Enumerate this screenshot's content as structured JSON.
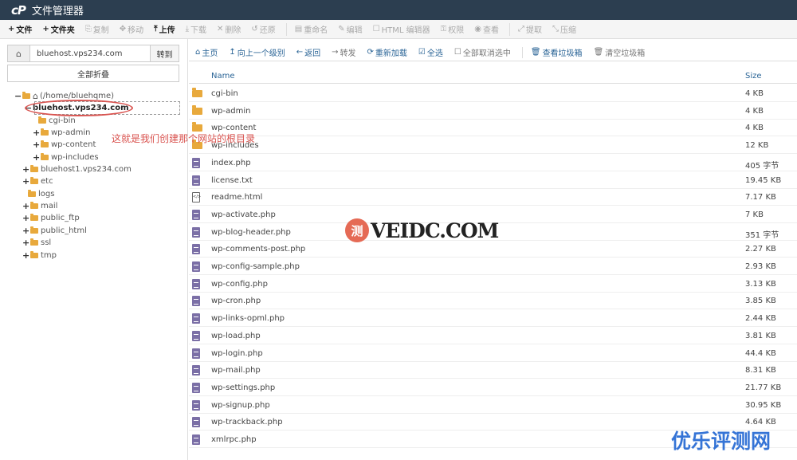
{
  "title_bar": {
    "logo": "cP",
    "title": "文件管理器"
  },
  "toolbar": [
    {
      "icon": "+",
      "label": "文件",
      "enabled": true
    },
    {
      "icon": "+",
      "label": "文件夹",
      "enabled": true
    },
    {
      "icon": "⎘",
      "label": "复制",
      "enabled": false
    },
    {
      "icon": "✥",
      "label": "移动",
      "enabled": false
    },
    {
      "icon": "⤒",
      "label": "上传",
      "enabled": true
    },
    {
      "icon": "⤓",
      "label": "下载",
      "enabled": false
    },
    {
      "icon": "✕",
      "label": "删除",
      "enabled": false
    },
    {
      "icon": "↺",
      "label": "还原",
      "enabled": false
    },
    {
      "icon": "▤",
      "label": "重命名",
      "enabled": false
    },
    {
      "icon": "✎",
      "label": "编辑",
      "enabled": false
    },
    {
      "icon": "☐",
      "label": "HTML 编辑器",
      "enabled": false
    },
    {
      "icon": "⚿",
      "label": "权限",
      "enabled": false
    },
    {
      "icon": "◉",
      "label": "查看",
      "enabled": false
    },
    {
      "icon": "⤢",
      "label": "提取",
      "enabled": false
    },
    {
      "icon": "⤡",
      "label": "压缩",
      "enabled": false
    }
  ],
  "left_panel": {
    "path_value": "bluehost.vps234.com",
    "go_label": "转到",
    "collapse_label": "全部折叠",
    "tree": [
      {
        "toggle": "−",
        "label": "(/home/bluehqme)",
        "home": true
      },
      {
        "toggle": "−",
        "label": "bluehost.vps234.com",
        "selected": true
      },
      {
        "toggle": "",
        "label": "cgi-bin"
      },
      {
        "toggle": "+",
        "label": "wp-admin"
      },
      {
        "toggle": "+",
        "label": "wp-content"
      },
      {
        "toggle": "+",
        "label": "wp-includes"
      },
      {
        "toggle": "+",
        "label": "bluehost1.vps234.com"
      },
      {
        "toggle": "+",
        "label": "etc"
      },
      {
        "toggle": "",
        "label": "logs"
      },
      {
        "toggle": "+",
        "label": "mail"
      },
      {
        "toggle": "+",
        "label": "public_ftp"
      },
      {
        "toggle": "+",
        "label": "public_html"
      },
      {
        "toggle": "+",
        "label": "ssl"
      },
      {
        "toggle": "+",
        "label": "tmp"
      }
    ]
  },
  "actions": [
    {
      "icon": "⌂",
      "label": "主页"
    },
    {
      "icon": "↥",
      "label": "向上一个级别"
    },
    {
      "icon": "←",
      "label": "返回"
    },
    {
      "icon": "→",
      "label": "转发",
      "dim": true
    },
    {
      "icon": "⟳",
      "label": "重新加载"
    },
    {
      "icon": "☑",
      "label": "全选"
    },
    {
      "icon": "☐",
      "label": "全部取消选中",
      "dim": true
    },
    {
      "icon": "🗑",
      "label": "查看垃圾箱"
    },
    {
      "icon": "🗑",
      "label": "清空垃圾箱",
      "dim": true
    }
  ],
  "table": {
    "col_name": "Name",
    "col_size": "Size",
    "rows": [
      {
        "type": "folder",
        "name": "cgi-bin",
        "size": "4 KB"
      },
      {
        "type": "folder",
        "name": "wp-admin",
        "size": "4 KB"
      },
      {
        "type": "folder",
        "name": "wp-content",
        "size": "4 KB"
      },
      {
        "type": "folder",
        "name": "wp-includes",
        "size": "12 KB"
      },
      {
        "type": "doc",
        "name": "index.php",
        "size": "405 字节"
      },
      {
        "type": "doc",
        "name": "license.txt",
        "size": "19.45 KB"
      },
      {
        "type": "html",
        "name": "readme.html",
        "size": "7.17 KB"
      },
      {
        "type": "doc",
        "name": "wp-activate.php",
        "size": "7 KB"
      },
      {
        "type": "doc",
        "name": "wp-blog-header.php",
        "size": "351 字节"
      },
      {
        "type": "doc",
        "name": "wp-comments-post.php",
        "size": "2.27 KB"
      },
      {
        "type": "doc",
        "name": "wp-config-sample.php",
        "size": "2.93 KB"
      },
      {
        "type": "doc",
        "name": "wp-config.php",
        "size": "3.13 KB"
      },
      {
        "type": "doc",
        "name": "wp-cron.php",
        "size": "3.85 KB"
      },
      {
        "type": "doc",
        "name": "wp-links-opml.php",
        "size": "2.44 KB"
      },
      {
        "type": "doc",
        "name": "wp-load.php",
        "size": "3.81 KB"
      },
      {
        "type": "doc",
        "name": "wp-login.php",
        "size": "44.4 KB"
      },
      {
        "type": "doc",
        "name": "wp-mail.php",
        "size": "8.31 KB"
      },
      {
        "type": "doc",
        "name": "wp-settings.php",
        "size": "21.77 KB"
      },
      {
        "type": "doc",
        "name": "wp-signup.php",
        "size": "30.95 KB"
      },
      {
        "type": "doc",
        "name": "wp-trackback.php",
        "size": "4.64 KB"
      },
      {
        "type": "doc",
        "name": "xmlrpc.php",
        "size": ""
      }
    ]
  },
  "annotation": "这就是我们创建那个网站的根目录",
  "watermark": {
    "badge": "测",
    "text": "VEIDC.COM",
    "brand": "优乐评测网"
  },
  "colors": {
    "title_bar": "#2c3e50",
    "link": "#2a6496",
    "folder": "#e8a93c",
    "annotation": "#d9534f",
    "brand": "#3574d6"
  }
}
